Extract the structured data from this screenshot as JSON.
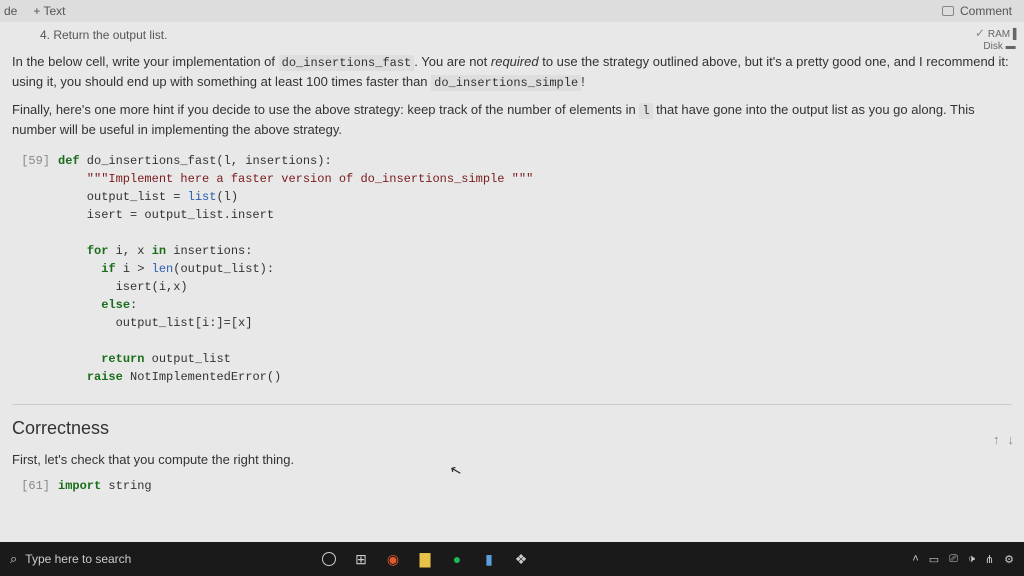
{
  "topbar": {
    "code_label": "de",
    "text_label": "+ Text",
    "comment_label": "Comment"
  },
  "status": {
    "ram": "RAM",
    "disk": "Disk"
  },
  "prev_item": "4. Return the output list.",
  "para1_a": "In the below cell, write your implementation of ",
  "para1_code1": "do_insertions_fast",
  "para1_b": ". You are not ",
  "para1_em": "required",
  "para1_c": " to use the strategy outlined above, but it's a pretty good one, and I recommend it: using it, you should end up with something at least 100 times faster than ",
  "para1_code2": "do_insertions_simple",
  "para1_d": "!",
  "para2_a": "Finally, here's one more hint if you decide to use the above strategy: keep track of the number of elements in ",
  "para2_code": "l",
  "para2_b": " that have gone into the output list as you go along. This number will be useful in implementing the above strategy.",
  "cell59": {
    "gutter": "[59]",
    "line1_def": "def",
    "line1_name": " do_insertions_fast(l, insertions):",
    "line2": "    \"\"\"Implement here a faster version of do_insertions_simple \"\"\"",
    "line3a": "    output_list = ",
    "line3b": "list",
    "line3c": "(l)",
    "line4": "    isert = output_list.insert",
    "blank": "",
    "line5a": "    ",
    "line5_for": "for",
    "line5b": " i, x ",
    "line5_in": "in",
    "line5c": " insertions:",
    "line6a": "      ",
    "line6_if": "if",
    "line6b": " i > ",
    "line6_len": "len",
    "line6c": "(output_list):",
    "line7": "        isert(i,x)",
    "line8a": "      ",
    "line8_else": "else",
    "line8b": ":",
    "line9": "        output_list[i:]=[x]",
    "line10a": "      ",
    "line10_ret": "return",
    "line10b": " output_list",
    "line11a": "    ",
    "line11_raise": "raise",
    "line11b": " NotImplementedError()"
  },
  "arrows": {
    "up": "↑",
    "down": "↓"
  },
  "section2": {
    "title": "Correctness",
    "text": "First, let's check that you compute the right thing."
  },
  "cell61": {
    "gutter": "[61]",
    "import": "import",
    "mod": " string"
  },
  "taskbar": {
    "search_placeholder": "Type here to search"
  }
}
